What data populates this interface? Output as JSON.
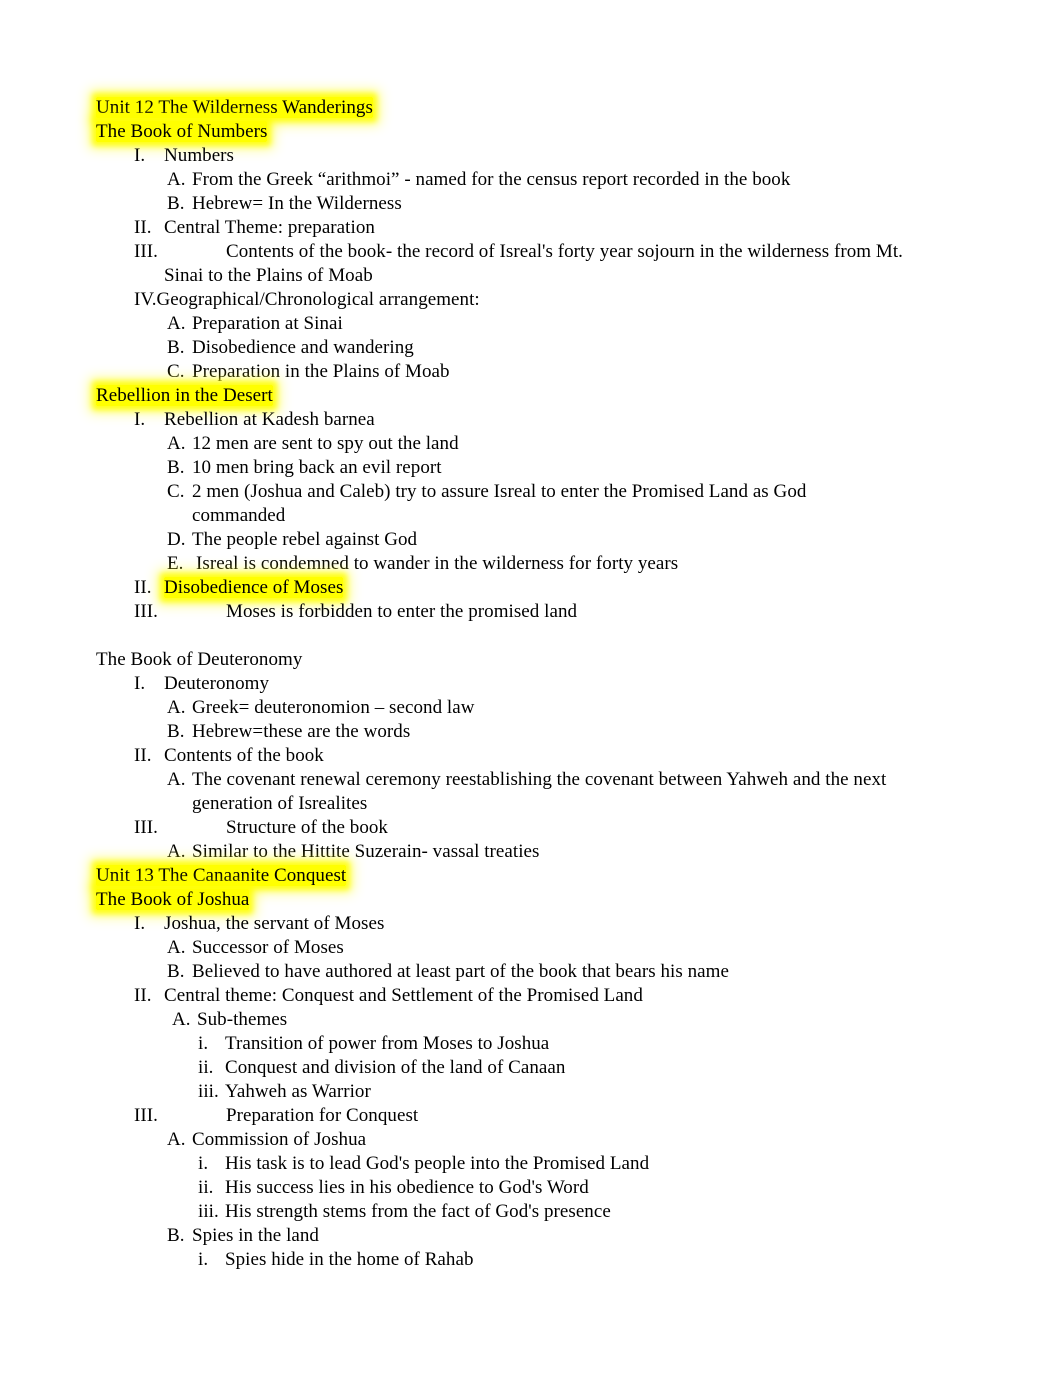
{
  "document": {
    "title": "Unit 12 The Wilderness Wanderings",
    "highlight_color": "#ffff00",
    "text_color": "#000000",
    "background_color": "#ffffff",
    "blocks": [
      {
        "id": "unit12-title",
        "text": "Unit 12 The Wilderness Wanderings",
        "level": "heading",
        "highlighted": true
      },
      {
        "id": "book-of-numbers",
        "text": "The Book of Numbers",
        "level": "heading",
        "highlighted": true
      },
      {
        "id": "numbers-I",
        "marker": "I.",
        "text": "Numbers",
        "level": "roman",
        "highlighted": false
      },
      {
        "id": "numbers-I-A",
        "marker": "A.",
        "text": "From the Greek “arithmoi” - named for the census report recorded in the book",
        "level": "alpha",
        "highlighted": false
      },
      {
        "id": "numbers-I-B",
        "marker": "B.",
        "text": "Hebrew= In the Wilderness",
        "level": "alpha",
        "highlighted": false
      },
      {
        "id": "numbers-II",
        "marker": "II.",
        "text": "Central Theme: preparation",
        "level": "roman",
        "highlighted": false
      },
      {
        "id": "numbers-III",
        "marker": "III.",
        "text": "Contents of the book- the record of Isreal's forty year sojourn in the wilderness from Mt.",
        "continuation": "Sinai to the Plains of Moab",
        "level": "roman-wide",
        "highlighted": false
      },
      {
        "id": "numbers-IV",
        "marker": "IV.",
        "text": "Geographical/Chronological arrangement:",
        "level": "roman-tight",
        "highlighted": false
      },
      {
        "id": "numbers-IV-A",
        "marker": "A.",
        "text": "Preparation at Sinai",
        "level": "alpha",
        "highlighted": false
      },
      {
        "id": "numbers-IV-B",
        "marker": "B.",
        "text": "Disobedience and wandering",
        "level": "alpha",
        "highlighted": false
      },
      {
        "id": "numbers-IV-C",
        "marker": "C.",
        "text": "Preparation in the Plains of Moab",
        "level": "alpha",
        "highlighted": false
      },
      {
        "id": "rebellion-heading",
        "text": "Rebellion in the Desert",
        "level": "heading",
        "highlighted": true
      },
      {
        "id": "rebellion-I",
        "marker": "I.",
        "text": "Rebellion at Kadesh barnea",
        "level": "roman",
        "highlighted": false
      },
      {
        "id": "rebellion-I-A",
        "marker": "A.",
        "text": "12 men are sent to spy out the land",
        "level": "alpha",
        "highlighted": false
      },
      {
        "id": "rebellion-I-B",
        "marker": "B.",
        "text": "10 men bring back an evil report",
        "level": "alpha",
        "highlighted": false
      },
      {
        "id": "rebellion-I-C",
        "marker": "C.",
        "text": "2 men (Joshua and Caleb) try to assure Isreal to enter the Promised Land as God",
        "continuation": "commanded",
        "level": "alpha",
        "highlighted": false
      },
      {
        "id": "rebellion-I-D",
        "marker": "D.",
        "text": "The people rebel against God",
        "level": "alpha",
        "highlighted": false
      },
      {
        "id": "rebellion-I-E",
        "marker": "E.",
        "text": "Isreal is condemned to wander in the wilderness for forty years",
        "level": "alpha-wide",
        "highlighted": false
      },
      {
        "id": "rebellion-II",
        "marker": "II.",
        "text": "Disobedience of Moses",
        "level": "roman",
        "highlighted": true
      },
      {
        "id": "rebellion-III",
        "marker": "III.",
        "text": "Moses is forbidden to enter the promised land",
        "level": "roman-wide",
        "highlighted": false
      },
      {
        "id": "spacer-1",
        "text": "",
        "level": "blank",
        "highlighted": false
      },
      {
        "id": "book-of-deuteronomy",
        "text": "The Book of Deuteronomy",
        "level": "heading",
        "highlighted": false
      },
      {
        "id": "deut-I",
        "marker": "I.",
        "text": "Deuteronomy",
        "level": "roman",
        "highlighted": false
      },
      {
        "id": "deut-I-A",
        "marker": "A.",
        "text": "Greek= deuteronomion – second law",
        "level": "alpha",
        "highlighted": false
      },
      {
        "id": "deut-I-B",
        "marker": "B.",
        "text": "Hebrew=these are the words",
        "level": "alpha",
        "highlighted": false
      },
      {
        "id": "deut-II",
        "marker": "II.",
        "text": "Contents of the book",
        "level": "roman",
        "highlighted": false
      },
      {
        "id": "deut-II-A",
        "marker": "A.",
        "text": "The covenant renewal ceremony reestablishing the covenant between Yahweh and the next",
        "continuation": "generation of Isrealites",
        "level": "alpha",
        "highlighted": false
      },
      {
        "id": "deut-III",
        "marker": "III.",
        "text": "Structure of the book",
        "level": "roman-wide",
        "highlighted": false
      },
      {
        "id": "deut-III-A",
        "marker": "A.",
        "text": "Similar to the Hittite Suzerain- vassal treaties",
        "level": "alpha",
        "highlighted": false
      },
      {
        "id": "unit13-title",
        "text": "Unit 13 The Canaanite Conquest",
        "level": "heading",
        "highlighted": true
      },
      {
        "id": "book-of-joshua",
        "text": "The Book of Joshua",
        "level": "heading",
        "highlighted": true
      },
      {
        "id": "joshua-I",
        "marker": "I.",
        "text": "Joshua, the servant of Moses",
        "level": "roman",
        "highlighted": false
      },
      {
        "id": "joshua-I-A",
        "marker": "A.",
        "text": "Successor of Moses",
        "level": "alpha",
        "highlighted": false
      },
      {
        "id": "joshua-I-B",
        "marker": "B.",
        "text": "Believed to have authored at least part of the book that bears his name",
        "level": "alpha",
        "highlighted": false
      },
      {
        "id": "joshua-II",
        "marker": "II.",
        "text": "Central theme: Conquest and Settlement of the Promised Land",
        "level": "roman",
        "highlighted": false
      },
      {
        "id": "joshua-II-A",
        "marker": "A.",
        "text": "Sub-themes",
        "level": "alpha-wide2",
        "highlighted": false
      },
      {
        "id": "joshua-II-A-i",
        "marker": "i.",
        "text": "Transition of power from Moses to Joshua",
        "level": "lroman",
        "highlighted": false
      },
      {
        "id": "joshua-II-A-ii",
        "marker": "ii.",
        "text": "Conquest and division of the land of Canaan",
        "level": "lroman",
        "highlighted": false
      },
      {
        "id": "joshua-II-A-iii",
        "marker": "iii.",
        "text": "Yahweh as Warrior",
        "level": "lroman",
        "highlighted": false
      },
      {
        "id": "joshua-III",
        "marker": "III.",
        "text": "Preparation for Conquest",
        "level": "roman-wide",
        "highlighted": false
      },
      {
        "id": "joshua-III-A",
        "marker": "A.",
        "text": "Commission of Joshua",
        "level": "alpha",
        "highlighted": false
      },
      {
        "id": "joshua-III-A-i",
        "marker": "i.",
        "text": "His task is to lead God's people into the Promised Land",
        "level": "lroman",
        "highlighted": false
      },
      {
        "id": "joshua-III-A-ii",
        "marker": "ii.",
        "text": "His success lies in his obedience to God's Word",
        "level": "lroman",
        "highlighted": false
      },
      {
        "id": "joshua-III-A-iii",
        "marker": "iii.",
        "text": "His strength stems from the fact of God's presence",
        "level": "lroman",
        "highlighted": false
      },
      {
        "id": "joshua-III-B",
        "marker": "B.",
        "text": "Spies in the land",
        "level": "alpha",
        "highlighted": false
      },
      {
        "id": "joshua-III-B-i",
        "marker": "i.",
        "text": "Spies hide in the home of Rahab",
        "level": "lroman",
        "highlighted": false
      }
    ]
  }
}
